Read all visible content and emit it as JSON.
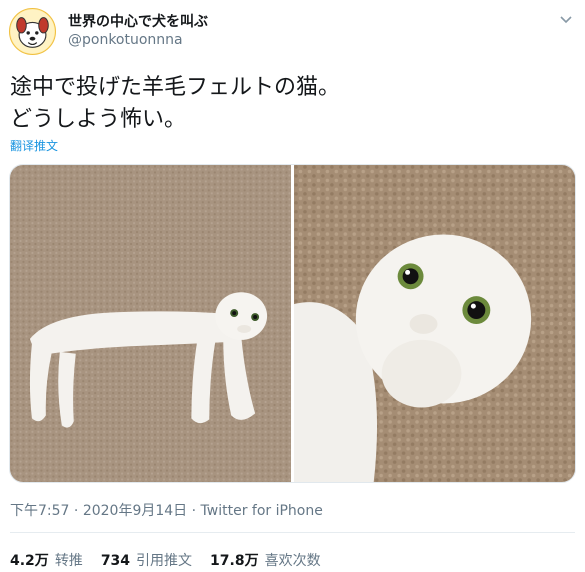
{
  "author": {
    "display_name": "世界の中心で犬を叫ぶ",
    "handle": "@ponkotuonnna"
  },
  "tweet": {
    "text": "途中で投げた羊毛フェルトの猫。\nどうしよう怖い。",
    "translate_label": "翻译推文",
    "time": "下午7:57",
    "date": "2020年9月14日",
    "separator": " · ",
    "source": "Twitter for iPhone"
  },
  "stats": {
    "retweets": {
      "count": "4.2万",
      "label": "转推"
    },
    "quotes": {
      "count": "734",
      "label": "引用推文"
    },
    "likes": {
      "count": "17.8万",
      "label": "喜欢次数"
    }
  },
  "media": [
    {
      "icon": "photo-felt-cat-full-body"
    },
    {
      "icon": "photo-felt-cat-face-closeup"
    }
  ],
  "colors": {
    "text": "#14171a",
    "muted": "#657786",
    "link": "#1b95e0",
    "carpet": "#a8927a"
  }
}
